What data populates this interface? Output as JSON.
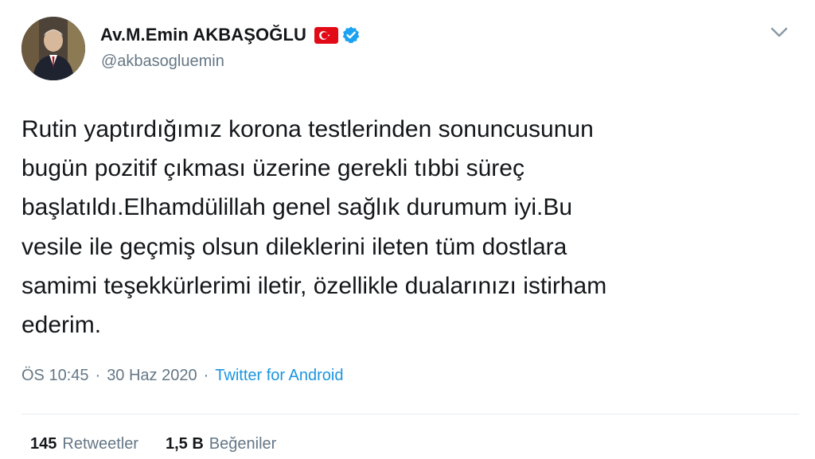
{
  "author": {
    "display_name": "Av.M.Emin AKBAŞOĞLU",
    "handle": "@akbasogluemin",
    "flag_icon": "turkey-flag-icon",
    "verified_icon": "verified-badge-icon",
    "verified_color": "#1da1f2"
  },
  "tweet": {
    "text": "Rutin yaptırdığımız korona testlerinden sonuncusunun\nbugün pozitif çıkması üzerine gerekli tıbbi süreç\nbaşlatıldı.Elhamdülillah genel sağlık durumum iyi.Bu\nvesile ile geçmiş olsun dileklerini ileten tüm dostlara\nsamimi teşekkürlerimi iletir, özellikle dualarınızı istirham\nederim.",
    "time": "ÖS 10:45",
    "separator": "·",
    "date": "30 Haz 2020",
    "source": "Twitter for Android"
  },
  "stats": {
    "retweets_count": "145",
    "retweets_label": "Retweetler",
    "likes_count": "1,5 B",
    "likes_label": "Beğeniler"
  },
  "colors": {
    "link": "#1b95e0",
    "muted": "#657786",
    "text": "#14171a",
    "flag_red": "#e30a17"
  }
}
